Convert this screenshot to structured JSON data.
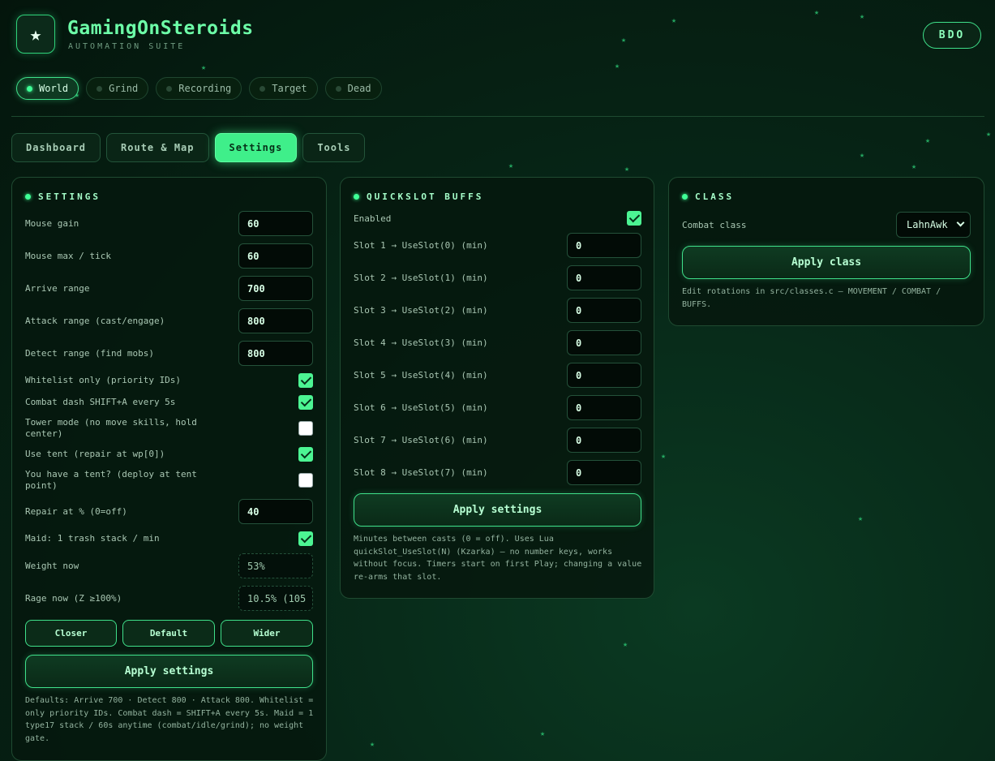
{
  "app": {
    "title": "GamingOnSteroids",
    "subtitle": "AUTOMATION SUITE",
    "logo_icon": "star-icon",
    "game_badge": "BDO"
  },
  "status_pills": [
    {
      "label": "World",
      "active": true
    },
    {
      "label": "Grind",
      "active": false
    },
    {
      "label": "Recording",
      "active": false
    },
    {
      "label": "Target",
      "active": false
    },
    {
      "label": "Dead",
      "active": false
    }
  ],
  "tabs": [
    {
      "label": "Dashboard",
      "active": false
    },
    {
      "label": "Route & Map",
      "active": false
    },
    {
      "label": "Settings",
      "active": true
    },
    {
      "label": "Tools",
      "active": false
    }
  ],
  "settings": {
    "title": "SETTINGS",
    "inputs": [
      {
        "label": "Mouse gain",
        "value": "60"
      },
      {
        "label": "Mouse max / tick",
        "value": "60"
      },
      {
        "label": "Arrive range",
        "value": "700"
      },
      {
        "label": "Attack range (cast/engage)",
        "value": "800"
      },
      {
        "label": "Detect range (find mobs)",
        "value": "800"
      }
    ],
    "checks": [
      {
        "label": "Whitelist only (priority IDs)",
        "checked": true
      },
      {
        "label": "Combat dash SHIFT+A every 5s",
        "checked": true
      },
      {
        "label": "Tower mode (no move skills, hold center)",
        "checked": false
      },
      {
        "label": "Use tent (repair at wp[0])",
        "checked": true
      },
      {
        "label": "You have a tent? (deploy at tent point)",
        "checked": false
      }
    ],
    "repair": {
      "label": "Repair at % (0=off)",
      "value": "40"
    },
    "maid": {
      "label": "Maid: 1 trash stack / min",
      "checked": true
    },
    "weight": {
      "label": "Weight now",
      "value": "53%"
    },
    "rage": {
      "label": "Rage now (Z ≥100%)",
      "value": "10.5% (105"
    },
    "preset_buttons": [
      "Closer",
      "Default",
      "Wider"
    ],
    "apply_label": "Apply settings",
    "note": "Defaults: Arrive 700 · Detect 800 · Attack 800. Whitelist = only priority IDs. Combat dash = SHIFT+A every 5s. Maid = 1 type17 stack / 60s anytime (combat/idle/grind); no weight gate."
  },
  "quickslot": {
    "title": "QUICKSLOT BUFFS",
    "enabled_label": "Enabled",
    "enabled": true,
    "slots": [
      {
        "label": "Slot 1 → UseSlot(0) (min)",
        "value": "0"
      },
      {
        "label": "Slot 2 → UseSlot(1) (min)",
        "value": "0"
      },
      {
        "label": "Slot 3 → UseSlot(2) (min)",
        "value": "0"
      },
      {
        "label": "Slot 4 → UseSlot(3) (min)",
        "value": "0"
      },
      {
        "label": "Slot 5 → UseSlot(4) (min)",
        "value": "0"
      },
      {
        "label": "Slot 6 → UseSlot(5) (min)",
        "value": "0"
      },
      {
        "label": "Slot 7 → UseSlot(6) (min)",
        "value": "0"
      },
      {
        "label": "Slot 8 → UseSlot(7) (min)",
        "value": "0"
      }
    ],
    "apply_label": "Apply settings",
    "note": "Minutes between casts (0 = off). Uses Lua quickSlot_UseSlot(N) (Kzarka) — no number keys, works without focus. Timers start on first Play; changing a value re-arms that slot."
  },
  "class": {
    "title": "CLASS",
    "combat_label": "Combat class",
    "combat_value": "LahnAwk",
    "apply_label": "Apply class",
    "note": "Edit rotations in src/classes.c — MOVEMENT / COMBAT / BUFFS."
  },
  "colors": {
    "accent": "#3fef8a",
    "background": "#04150c",
    "panel": "#06180e"
  }
}
